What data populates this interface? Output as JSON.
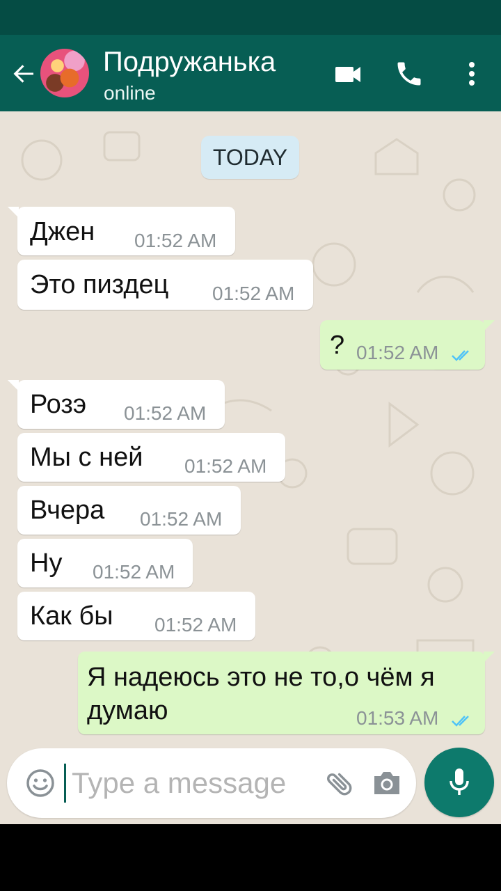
{
  "header": {
    "contact_name": "Подружанька",
    "status": "online",
    "icons": [
      "back-arrow-icon",
      "video-call-icon",
      "phone-icon",
      "more-vert-icon"
    ]
  },
  "chat": {
    "date_chip": "TODAY",
    "messages": [
      {
        "direction": "in",
        "text": "Джен",
        "time": "01:52 AM"
      },
      {
        "direction": "in",
        "text": "Это пиздец",
        "time": "01:52 AM"
      },
      {
        "direction": "out",
        "text": "?",
        "time": "01:52 AM",
        "read": true
      },
      {
        "direction": "in",
        "text": "Розэ",
        "time": "01:52 AM"
      },
      {
        "direction": "in",
        "text": "Мы с ней",
        "time": "01:52 AM"
      },
      {
        "direction": "in",
        "text": "Вчера",
        "time": "01:52 AM"
      },
      {
        "direction": "in",
        "text": "Ну",
        "time": "01:52 AM"
      },
      {
        "direction": "in",
        "text": "Как бы",
        "time": "01:52 AM"
      },
      {
        "direction": "out",
        "text_line1": "Я надеюсь это не то,о чём я",
        "text_line2": "думаю",
        "time": "01:53 AM",
        "read": true
      }
    ]
  },
  "composer": {
    "placeholder": "Type a message",
    "icons": [
      "emoji-icon",
      "attach-icon",
      "camera-icon",
      "mic-icon"
    ]
  },
  "colors": {
    "header": "#075e54",
    "status_bar": "#054c44",
    "outgoing_bubble": "#dcf8c6",
    "incoming_bubble": "#ffffff",
    "read_ticks": "#4fc3f7",
    "chat_background": "#e9e2d8"
  }
}
